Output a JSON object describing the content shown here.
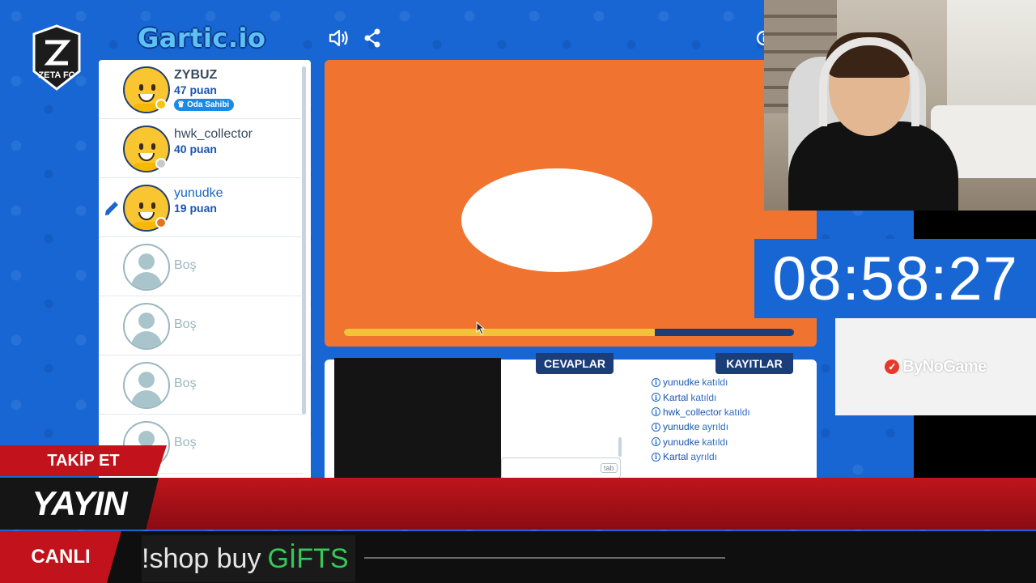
{
  "app": {
    "logo_text": "Gartic.io",
    "zeta_logo_text": "ZETA FC"
  },
  "players": [
    {
      "name": "ZYBUZ",
      "score": "47 puan",
      "badge": "Oda Sahibi",
      "status_color": "#f5c216"
    },
    {
      "name": "hwk_collector",
      "score": "40 puan",
      "status_color": "#c9c9c9"
    },
    {
      "name": "yunudke",
      "score": "19 puan",
      "status_color": "#e8731e",
      "drawing": true
    }
  ],
  "empty_slots": [
    "Boş",
    "Boş",
    "Boş",
    "Boş"
  ],
  "tabs": {
    "answers": "CEVAPLAR",
    "logs": "KAYITLAR"
  },
  "answer_input": {
    "shortcut": "tab"
  },
  "logs": [
    {
      "user": "yunudke",
      "action": "katıldı"
    },
    {
      "user": "Kartal",
      "action": "katıldı"
    },
    {
      "user": "hwk_collector",
      "action": "katıldı"
    },
    {
      "user": "yunudke",
      "action": "ayrıldı"
    },
    {
      "user": "yunudke",
      "action": "katıldı"
    },
    {
      "user": "Kartal",
      "action": "ayrıldı"
    }
  ],
  "round_timer": {
    "remaining_fraction": 0.69
  },
  "stream": {
    "countdown": "08:58:27",
    "sponsor": "ByNoGame",
    "follow_label": "TAKİP ET",
    "banner_label": "YAYIN",
    "live_label": "CANLI",
    "ticker_text": "!shop buy",
    "ticker_highlight": "GİFTS"
  },
  "colors": {
    "background": "#1766d4",
    "canvas": "#f07430",
    "accent_dark": "#1b3e7a",
    "stream_red": "#c2121b"
  }
}
